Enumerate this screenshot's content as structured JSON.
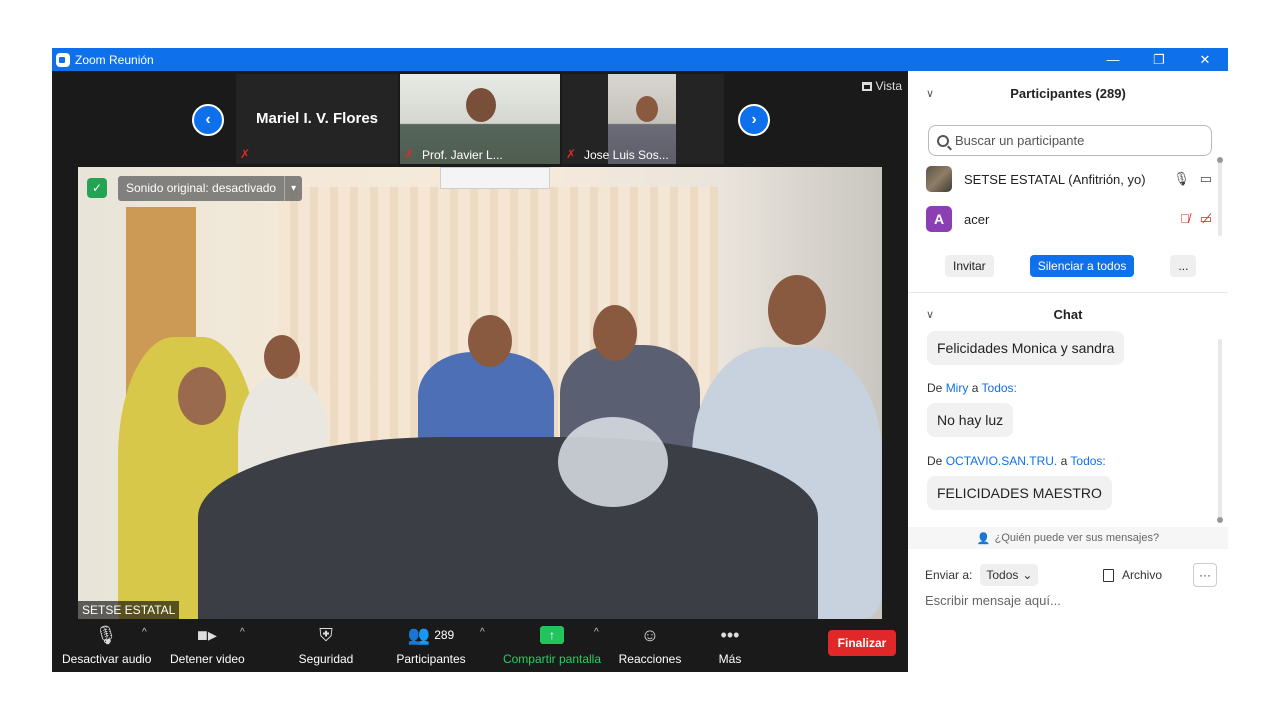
{
  "window": {
    "title": "Zoom Reunión",
    "controls": [
      "—",
      "❐",
      "✕"
    ]
  },
  "gallery": {
    "tiles": [
      {
        "name": "Mariel I. V. Flores",
        "type": "name-only"
      },
      {
        "name": "Prof. Javier L...",
        "type": "video"
      },
      {
        "name": "Jose Luis Sos...",
        "type": "video"
      }
    ],
    "prev_icon": "‹",
    "next_icon": "›",
    "view_label": "Vista"
  },
  "main_video": {
    "sound_label": "Sonido original: desactivado",
    "self_label": "SETSE ESTATAL"
  },
  "toolbar": {
    "mute_label": "Desactivar audio",
    "video_label": "Detener video",
    "security_label": "Seguridad",
    "participants_label": "Participantes",
    "participants_count": "289",
    "share_label": "Compartir pantalla",
    "reactions_label": "Reacciones",
    "more_label": "Más",
    "end_label": "Finalizar"
  },
  "participants_panel": {
    "title": "Participantes (289)",
    "search_placeholder": "Buscar un participante",
    "list": [
      {
        "name": "SETSE ESTATAL (Anfitrión, yo)",
        "avatar": "",
        "muted": false
      },
      {
        "name": "acer",
        "avatar": "A",
        "muted": true
      }
    ],
    "invite_label": "Invitar",
    "mute_all_label": "Silenciar a todos",
    "more_label": "..."
  },
  "chat": {
    "title": "Chat",
    "messages": [
      {
        "from": "",
        "to": "",
        "text": "Felicidades Monica y sandra"
      },
      {
        "from": "Miry",
        "to": "Todos:",
        "text": "No hay luz"
      },
      {
        "from": "OCTAVIO.SAN.TRU.",
        "to": "Todos:",
        "text": "FELICIDADES MAESTRO"
      }
    ],
    "de": "De",
    "a": "a",
    "who_can_see": "¿Quién puede ver sus mensajes?",
    "send_to_label": "Enviar a:",
    "send_to_value": "Todos",
    "file_label": "Archivo",
    "input_placeholder": "Escribir mensaje aquí..."
  },
  "colors": {
    "accent": "#0e71eb",
    "danger": "#e02828",
    "share": "#23c45e"
  }
}
